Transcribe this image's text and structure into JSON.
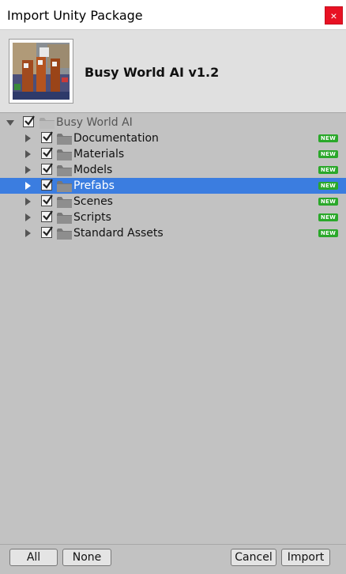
{
  "window": {
    "title": "Import Unity Package",
    "close_glyph": "×"
  },
  "package": {
    "name": "Busy World AI v1.2",
    "thumbnail_icon": "package-preview-image"
  },
  "tree": {
    "root": {
      "label": "Busy World AI",
      "checked": true,
      "expanded": true
    },
    "items": [
      {
        "label": "Documentation",
        "checked": true,
        "badge": "NEW",
        "selected": false
      },
      {
        "label": "Materials",
        "checked": true,
        "badge": "NEW",
        "selected": false
      },
      {
        "label": "Models",
        "checked": true,
        "badge": "NEW",
        "selected": false
      },
      {
        "label": "Prefabs",
        "checked": true,
        "badge": "NEW",
        "selected": true
      },
      {
        "label": "Scenes",
        "checked": true,
        "badge": "NEW",
        "selected": false
      },
      {
        "label": "Scripts",
        "checked": true,
        "badge": "NEW",
        "selected": false
      },
      {
        "label": "Standard Assets",
        "checked": true,
        "badge": "NEW",
        "selected": false
      }
    ]
  },
  "footer": {
    "all_label": "All",
    "none_label": "None",
    "cancel_label": "Cancel",
    "import_label": "Import"
  },
  "colors": {
    "selection": "#3b7de0",
    "badge": "#2aa82a",
    "close": "#e81123"
  }
}
